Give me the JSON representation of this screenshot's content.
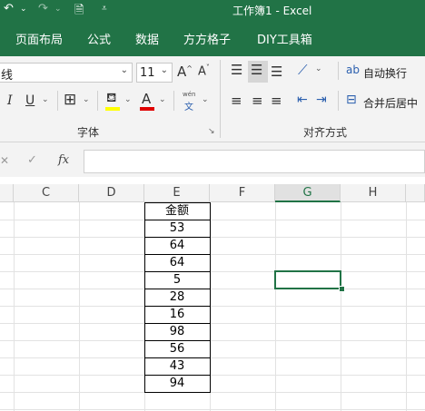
{
  "title_bar": {
    "title": "工作簿1  -  Excel"
  },
  "menu": {
    "tabs": [
      "页面布局",
      "公式",
      "数据",
      "方方格子",
      "DIY工具箱"
    ]
  },
  "ribbon": {
    "font_name_partial": "线",
    "font_size": "11",
    "increase_font": "A^",
    "decrease_font": "A˅",
    "italic": "I",
    "underline": "U",
    "pinyin_top": "wén",
    "pinyin_bottom": "文",
    "wrap_text_label": "自动换行",
    "merge_center_label": "合并后居中",
    "font_group_label": "字体",
    "alignment_group_label": "对齐方式",
    "accent_yellow": "#ffff00",
    "accent_red": "#e00000"
  },
  "formula_bar": {
    "fx": "fx",
    "value": ""
  },
  "grid": {
    "columns": [
      "C",
      "D",
      "E",
      "F",
      "G",
      "H"
    ],
    "selected_column": "G",
    "header_cell": "金额",
    "values": [
      "53",
      "64",
      "64",
      "5",
      "28",
      "16",
      "98",
      "56",
      "43",
      "94"
    ]
  },
  "theme": {
    "excel_green": "#217346"
  }
}
